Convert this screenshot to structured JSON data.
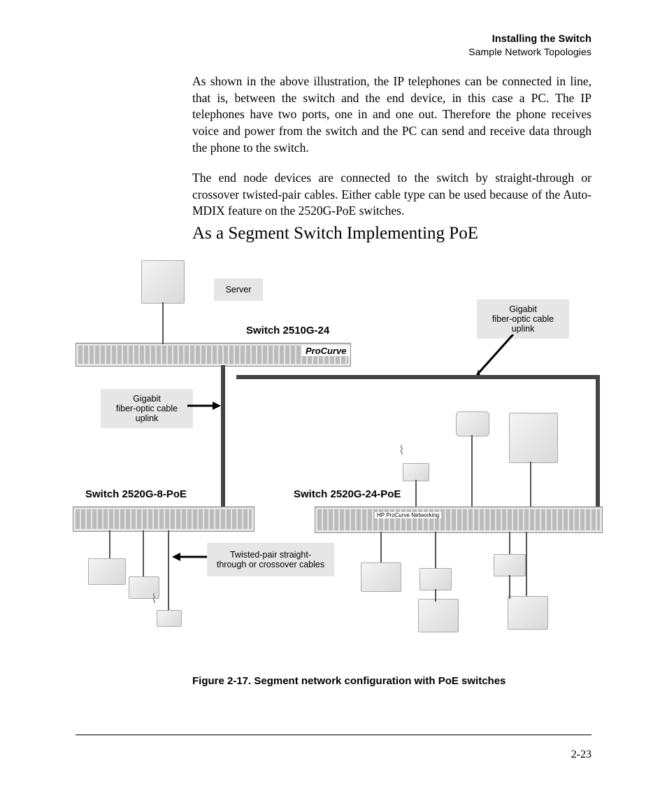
{
  "header": {
    "title": "Installing the Switch",
    "section": "Sample Network Topologies"
  },
  "paragraphs": {
    "p1": "As shown in the above illustration, the IP telephones can be connected in line, that is, between the switch and the end device, in this case a PC. The IP telephones have two ports, one in and one out. Therefore the phone receives voice and power from the switch and the PC can send and receive data through the phone to the switch.",
    "p2": "The end node devices are connected to the switch by straight-through or crossover twisted-pair cables. Either cable type can be used because of the Auto-MDIX feature on the 2520G-PoE switches."
  },
  "section_heading": "As a Segment Switch Implementing PoE",
  "figure": {
    "caption": "Figure 2-17.  Segment network configuration with PoE switches",
    "labels": {
      "server": "Server",
      "switch_top": "Switch 2510G-24",
      "switch_left": "Switch 2520G-8-PoE",
      "switch_right": "Switch 2520G-24-PoE",
      "uplink_left": "Gigabit\nfiber-optic cable\nuplink",
      "uplink_right": "Gigabit\nfiber-optic cable\nuplink",
      "tp": "Twisted-pair straight-\nthrough or crossover cables",
      "brand": "ProCurve",
      "brand2": "HP ProCurve Networking"
    }
  },
  "page_number": "2-23"
}
